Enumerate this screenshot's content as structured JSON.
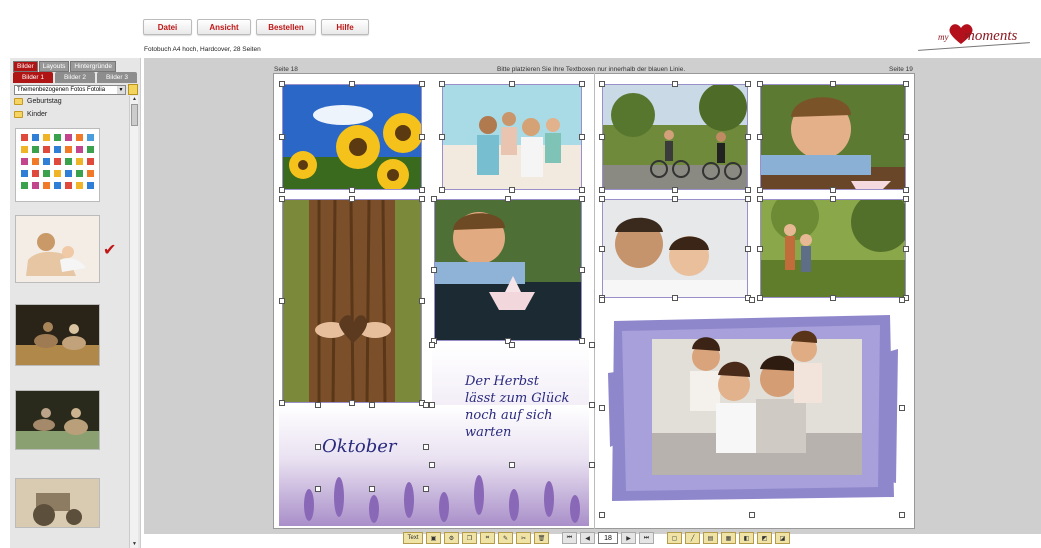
{
  "menu": {
    "datei": "Datei",
    "ansicht": "Ansicht",
    "bestellen": "Bestellen",
    "hilfe": "Hilfe"
  },
  "subtitle": "Fotobuch A4 hoch, Hardcover, 28 Seiten",
  "logo": {
    "my": "my",
    "brand": "moments"
  },
  "left": {
    "tabs": [
      "Bilder",
      "Layouts",
      "Hintergründe"
    ],
    "subtabs": [
      "Bilder 1",
      "Bilder 2",
      "Bilder 3"
    ],
    "select": "Themenbezogenen Fotos Fotolia",
    "folders": [
      "Geburtstag",
      "Kinder"
    ]
  },
  "page": {
    "left_label": "Seite 18",
    "right_label": "Seite 19",
    "notice": "Bitte platzieren Sie Ihre Textboxen nur innerhalb der blauen Linie."
  },
  "texts": {
    "oktober": "Oktober",
    "herbst1": "Der Herbst",
    "herbst2": "lässt zum Glück",
    "herbst3": "noch auf sich",
    "herbst4": "warten"
  },
  "toolbar": {
    "page": "18",
    "text": "Text"
  },
  "colors": {
    "accent": "#b01515",
    "frame": "#8f87cc",
    "page_bg": "#cfcfcf"
  }
}
